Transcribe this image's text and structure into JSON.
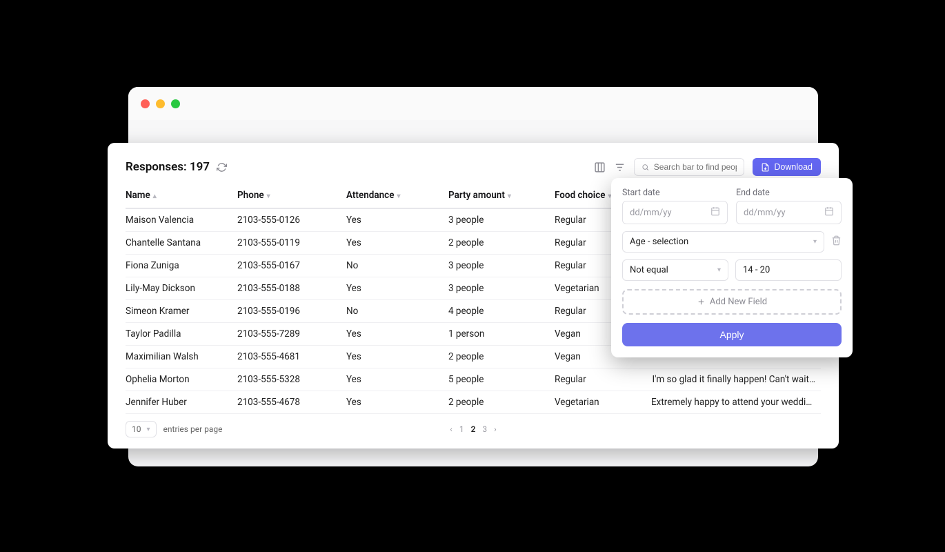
{
  "browser": {
    "title": ""
  },
  "header": {
    "responses_label": "Responses:",
    "responses_count": "197"
  },
  "toolbar": {
    "search_placeholder": "Search bar to find people",
    "download_label": "Download"
  },
  "columns": {
    "name": "Name",
    "phone": "Phone",
    "attendance": "Attendance",
    "party": "Party amount",
    "food": "Food choice"
  },
  "rows": [
    {
      "name": "Maison Valencia",
      "phone": "2103-555-0126",
      "attendance": "Yes",
      "party": "3 people",
      "food": "Regular",
      "note": ""
    },
    {
      "name": "Chantelle Santana",
      "phone": "2103-555-0119",
      "attendance": "Yes",
      "party": "2 people",
      "food": "Regular",
      "note": ""
    },
    {
      "name": "Fiona Zuniga",
      "phone": "2103-555-0167",
      "attendance": "No",
      "party": "3 people",
      "food": "Regular",
      "note": ""
    },
    {
      "name": "Lily-May Dickson",
      "phone": "2103-555-0188",
      "attendance": "Yes",
      "party": "3 people",
      "food": "Vegetarian",
      "note": ""
    },
    {
      "name": "Simeon Kramer",
      "phone": "2103-555-0196",
      "attendance": "No",
      "party": "4 people",
      "food": "Regular",
      "note": ""
    },
    {
      "name": "Taylor Padilla",
      "phone": "2103-555-7289",
      "attendance": "Yes",
      "party": "1 person",
      "food": "Vegan",
      "note": ""
    },
    {
      "name": "Maximilian Walsh",
      "phone": "2103-555-4681",
      "attendance": "Yes",
      "party": "2 people",
      "food": "Vegan",
      "note": ""
    },
    {
      "name": "Ophelia Morton",
      "phone": "2103-555-5328",
      "attendance": "Yes",
      "party": "5 people",
      "food": "Regular",
      "note": "I'm so glad it finally happen! Can't wait…"
    },
    {
      "name": "Jennifer Huber",
      "phone": "2103-555-4678",
      "attendance": "Yes",
      "party": "2 people",
      "food": "Vegetarian",
      "note": "Extremely happy to attend your wedding…"
    }
  ],
  "footer": {
    "page_size": "10",
    "entries_label": "entries per page",
    "pages": [
      "1",
      "2",
      "3"
    ],
    "active_page": "2"
  },
  "filter": {
    "start_label": "Start date",
    "end_label": "End date",
    "date_placeholder": "dd/mm/yy",
    "selection_label": "Age - selection",
    "condition_label": "Not equal",
    "condition_value": "14 - 20",
    "add_field_label": "Add New Field",
    "apply_label": "Apply"
  }
}
